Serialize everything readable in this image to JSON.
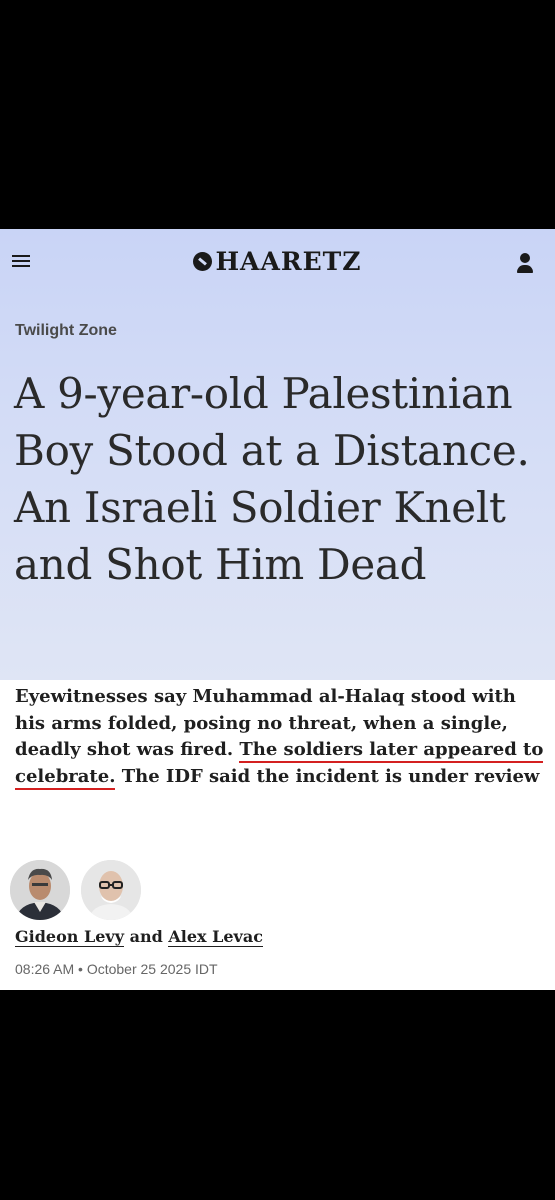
{
  "header": {
    "logo_text": "HAARETZ",
    "menu_icon": "hamburger-menu-icon",
    "account_icon": "user-icon"
  },
  "article": {
    "section": "Twilight Zone",
    "headline": "A 9-year-old Palestinian Boy Stood at a Distance. An Israeli Soldier Knelt and Shot Him Dead",
    "summary_part1": "Eyewitnesses say Muhammad al-Halaq stood with his arms folded, posing no threat, when a single, deadly shot was fired. ",
    "summary_highlight": "The soldiers later appeared to celebrate.",
    "summary_part2": " The IDF said the incident is under review",
    "authors": {
      "author1": "Gideon Levy",
      "joiner": " and ",
      "author2": "Alex Levac"
    },
    "timestamp": "08:26 AM • October 25 2025 IDT"
  },
  "colors": {
    "hero_background": "#d3dcf6",
    "underline_accent": "#d42020",
    "screen_background": "#000000"
  }
}
